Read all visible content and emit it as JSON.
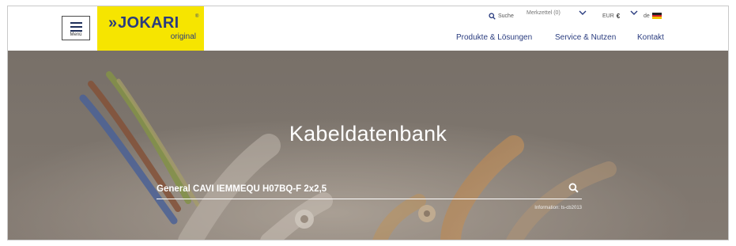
{
  "header": {
    "menu_label": "Menü",
    "logo": {
      "chevrons": "»",
      "brand": "JOKARI",
      "registered": "®",
      "subtitle": "original"
    },
    "utility": {
      "search_label": "Suche",
      "watchlist_label": "Merkzettel (0)",
      "currency_label": "EUR",
      "currency_symbol": "€",
      "language_label": "de"
    },
    "nav": [
      {
        "label": "Produkte & Lösungen"
      },
      {
        "label": "Service & Nutzen"
      },
      {
        "label": "Kontakt"
      }
    ]
  },
  "hero": {
    "title": "Kabeldatenbank",
    "search_value": "General CAVI IEMMEQU H07BQ-F 2x2,5",
    "info": "Information: ts-cb2013"
  },
  "colors": {
    "brand_yellow": "#f6e500",
    "brand_blue": "#2a3c7f",
    "hero_overlay": "#7f776f"
  },
  "icons": [
    "menu-icon",
    "search-icon",
    "chevron-down-icon",
    "german-flag-icon",
    "search-submit-icon"
  ]
}
